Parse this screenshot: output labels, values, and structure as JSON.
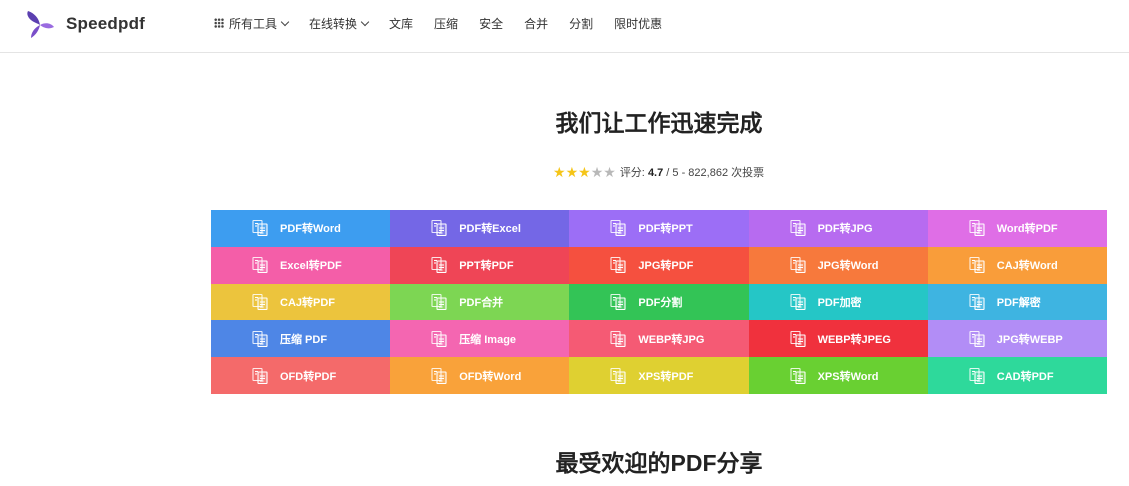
{
  "brand": {
    "name": "Speedpdf",
    "color": "#7a4fc9"
  },
  "nav": [
    {
      "label": "所有工具",
      "icon": "grid-icon",
      "dropdown": true
    },
    {
      "label": "在线转换",
      "dropdown": true
    },
    {
      "label": "文库"
    },
    {
      "label": "压缩"
    },
    {
      "label": "安全"
    },
    {
      "label": "合并"
    },
    {
      "label": "分割"
    },
    {
      "label": "限时优惠"
    }
  ],
  "hero": {
    "title": "我们让工作迅速完成"
  },
  "rating": {
    "score_label": "评分:",
    "score": "4.7",
    "suffix": "/ 5 - 822,862 次投票",
    "stars_filled": 3,
    "stars_total": 5
  },
  "tools": [
    {
      "label": "PDF转Word",
      "color": "#3d9df0",
      "icon": "pdf-to-word-icon"
    },
    {
      "label": "PDF转Excel",
      "color": "#7467e6",
      "icon": "pdf-to-excel-icon"
    },
    {
      "label": "PDF转PPT",
      "color": "#9c6ef6",
      "icon": "pdf-to-ppt-icon"
    },
    {
      "label": "PDF转JPG",
      "color": "#b76bf0",
      "icon": "pdf-to-jpg-icon"
    },
    {
      "label": "Word转PDF",
      "color": "#df6ee6",
      "icon": "word-to-pdf-icon"
    },
    {
      "label": "Excel转PDF",
      "color": "#f45ea8",
      "icon": "excel-to-pdf-icon"
    },
    {
      "label": "PPT转PDF",
      "color": "#ef4556",
      "icon": "ppt-to-pdf-icon"
    },
    {
      "label": "JPG转PDF",
      "color": "#f5503f",
      "icon": "jpg-to-pdf-icon"
    },
    {
      "label": "JPG转Word",
      "color": "#f7793c",
      "icon": "jpg-to-word-icon"
    },
    {
      "label": "CAJ转Word",
      "color": "#f99d3a",
      "icon": "caj-to-word-icon"
    },
    {
      "label": "CAJ转PDF",
      "color": "#ecc43d",
      "icon": "caj-to-pdf-icon"
    },
    {
      "label": "PDF合并",
      "color": "#7dd653",
      "icon": "pdf-merge-icon"
    },
    {
      "label": "PDF分割",
      "color": "#33c456",
      "icon": "pdf-split-icon"
    },
    {
      "label": "PDF加密",
      "color": "#25c6c6",
      "icon": "pdf-encrypt-icon"
    },
    {
      "label": "PDF解密",
      "color": "#3eb4e1",
      "icon": "pdf-decrypt-icon"
    },
    {
      "label": "压缩 PDF",
      "color": "#4e86e6",
      "icon": "compress-pdf-icon"
    },
    {
      "label": "压缩 Image",
      "color": "#f466b1",
      "icon": "compress-image-icon"
    },
    {
      "label": "WEBP转JPG",
      "color": "#f55a74",
      "icon": "webp-to-jpg-icon"
    },
    {
      "label": "WEBP转JPEG",
      "color": "#f0313d",
      "icon": "webp-to-jpeg-icon"
    },
    {
      "label": "JPG转WEBP",
      "color": "#b28df6",
      "icon": "jpg-to-webp-icon"
    },
    {
      "label": "OFD转PDF",
      "color": "#f46a6a",
      "icon": "ofd-to-pdf-icon"
    },
    {
      "label": "OFD转Word",
      "color": "#f9a23a",
      "icon": "ofd-to-word-icon"
    },
    {
      "label": "XPS转PDF",
      "color": "#dfd031",
      "icon": "xps-to-pdf-icon"
    },
    {
      "label": "XPS转Word",
      "color": "#69d032",
      "icon": "xps-to-word-icon"
    },
    {
      "label": "CAD转PDF",
      "color": "#2ed99b",
      "icon": "cad-to-pdf-icon"
    }
  ],
  "popular": {
    "title": "最受欢迎的PDF分享"
  }
}
